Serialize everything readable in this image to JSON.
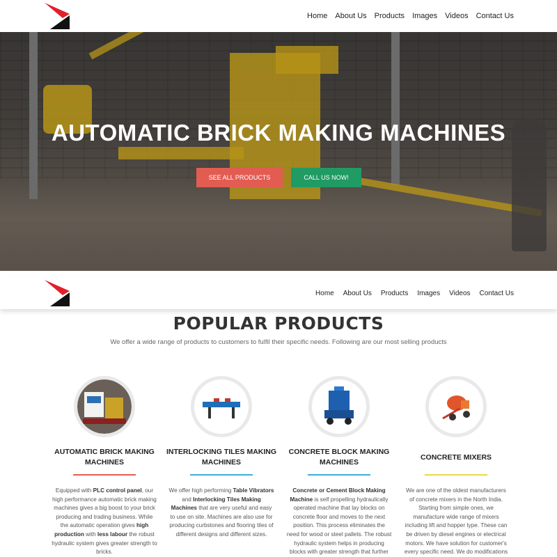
{
  "nav": {
    "items": [
      "Home",
      "About Us",
      "Products",
      "Images",
      "Videos",
      "Contact Us"
    ]
  },
  "hero": {
    "title": "AUTOMATIC BRICK MAKING MACHINES",
    "btn_products": "SEE ALL PRODUCTS",
    "btn_call": "CALL US NOW!"
  },
  "products_section": {
    "title": "POPULAR PRODUCTS",
    "subtitle": "We offer a wide range of products to customers to fulfil their specific needs. Following are our most selling products"
  },
  "cards": [
    {
      "title": "AUTOMATIC BRICK MAKING MACHINES",
      "rule_color": "#e25c52",
      "text_parts": [
        "Equipped with ",
        "PLC control panel",
        ", our high performance automatic brick making machines gives a big boost to your brick producing and trading business. While the automatic operation gives ",
        "high production",
        " with ",
        "less labour",
        " the robust hydraulic system gives greater strength to bricks."
      ]
    },
    {
      "title": "INTERLOCKING TILES MAKING MACHINES",
      "rule_color": "#3aaed8",
      "text_parts": [
        "We offer high performing ",
        "Table Vibrators",
        " and ",
        "Interlocking Tiles Making Machines",
        " that are very useful and easy to use on site. Machines are also use for producing curbstones and flooring tiles of different designs and different sizes."
      ]
    },
    {
      "title": "CONCRETE BLOCK MAKING MACHINES",
      "rule_color": "#3aaed8",
      "text_parts": [
        "",
        "Concrete or Cement Block Making Machine",
        " is self propelling hydraulically operated machine that lay blocks on concrete floor and moves to the next position. This process eliminates the need for wood or steel pallets. The robust hydraulic system helps in producing blocks with greater strength that further"
      ]
    },
    {
      "title": "CONCRETE MIXERS",
      "rule_color": "#e8d84a",
      "text_parts": [
        "We are one of the oldest manufacturers of concrete mixers in the North India. Starting from simple ones, we manufacture wide range of mixers including lift and hopper type. These can be driven by diesel engines or electrical motors. We have solution for customer's every specific need. We do modifications as per their needs."
      ]
    }
  ],
  "icons": [
    "brand-logo-icon"
  ]
}
